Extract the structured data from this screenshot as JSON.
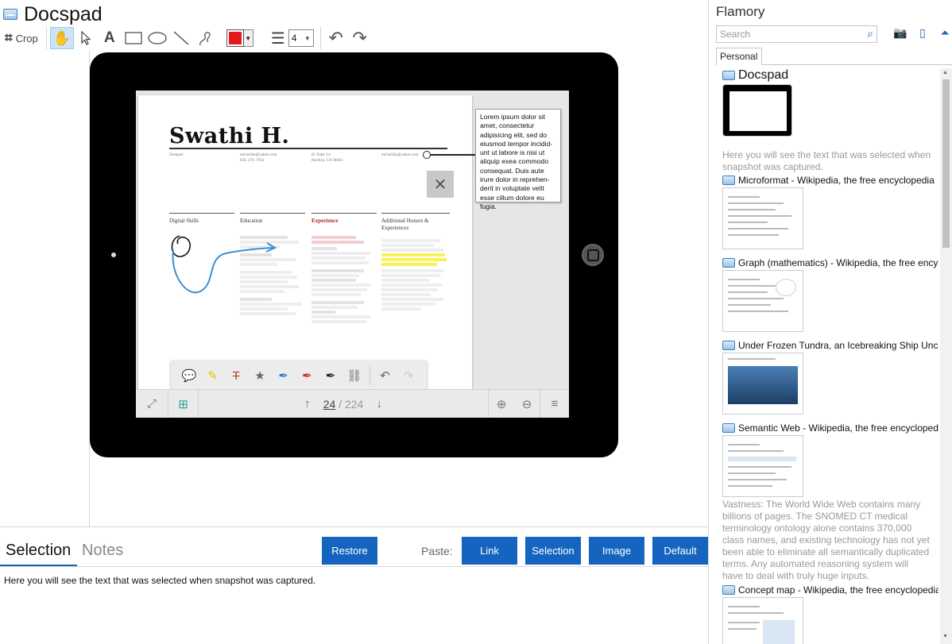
{
  "app": {
    "title": "Docspad"
  },
  "toolbar": {
    "crop_label": "Crop",
    "tools": [
      "hand-tool",
      "pointer-tool",
      "text-tool",
      "rectangle-tool",
      "ellipse-tool",
      "line-tool",
      "freehand-tool"
    ],
    "text_tool_glyph": "A",
    "stroke_color": "#e5191c",
    "line_width": "4"
  },
  "document": {
    "name": "Swathi H.",
    "role": "Designer",
    "email": "michellab@yahoo.com",
    "phone": "858. 376. 7934",
    "address_line1": "81 Elder Ln",
    "address_line2": "Pacifica, CA 94044",
    "web": "michellab@yahoo.com",
    "sections": {
      "skills": "Digital Skills",
      "education": "Education",
      "experience": "Experience",
      "honors": "Additional Honors & Experiences"
    },
    "annotation": "Lorem ipsum dolor sit amet, consectetur adipisicing elit, sed do eiusmod tempor incidid-unt ut labore is nisi ut aliquip exea commodo consequat. Duis aute irure dolor in reprehen-derit in voluptate velit esse cillum dolore eu fugia.",
    "page_current": "24",
    "page_total": "224"
  },
  "bottom": {
    "tab_selection": "Selection",
    "tab_notes": "Notes",
    "restore": "Restore",
    "paste_label": "Paste:",
    "paste_buttons": [
      "Link",
      "Selection",
      "Image",
      "Default"
    ],
    "selection_text": "Here you will see the text that was selected when snapshot was captured."
  },
  "flamory": {
    "title": "Flamory",
    "search_placeholder": "Search",
    "tab": "Personal",
    "items": [
      {
        "title": "Docspad",
        "desc": "Here you will see the text that was selected when snapshot was captured."
      },
      {
        "title": "Microformat - Wikipedia, the free encyclopedia"
      },
      {
        "title": "Graph (mathematics) - Wikipedia, the free ency"
      },
      {
        "title": "Under Frozen Tundra, an Icebreaking Ship Unco"
      },
      {
        "title": "Semantic Web - Wikipedia, the free encycloped",
        "desc": "Vastness: The World Wide Web contains many billions of pages. The SNOMED CT medical terminology ontology alone contains 370,000 class names, and existing technology has not yet been able to eliminate all semantically duplicated terms. Any automated reasoning system will have to deal with truly huge inputs."
      },
      {
        "title": "Concept map - Wikipedia, the free encyclopedia"
      }
    ]
  }
}
